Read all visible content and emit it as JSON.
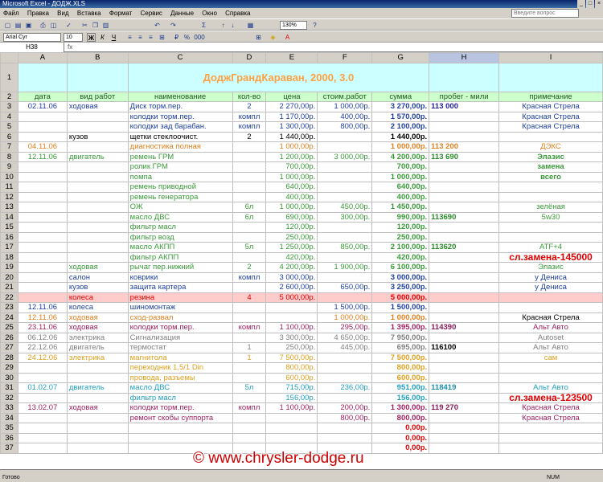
{
  "window": {
    "title": "Microsoft Excel - ДОДЖ.XLS",
    "minimize": "_",
    "maximize": "□",
    "close": "×"
  },
  "menu": {
    "items": [
      "Файл",
      "Правка",
      "Вид",
      "Вставка",
      "Формат",
      "Сервис",
      "Данные",
      "Окно",
      "Справка"
    ],
    "help_placeholder": "Введите вопрос"
  },
  "toolbar": {
    "zoom": "130%",
    "font_name": "Arial Cyr",
    "font_size": "10",
    "bold": "Ж",
    "italic": "К",
    "underline": "Ч",
    "sum": "Σ",
    "percent": "%",
    "thousands": "000"
  },
  "formula_bar": {
    "name_box": "H38",
    "fx": "fx"
  },
  "columns": [
    "A",
    "B",
    "C",
    "D",
    "E",
    "F",
    "G",
    "H",
    "I"
  ],
  "selected_column": "H",
  "banner_title": "ДоджГрандКараван, 2000, 3.0",
  "headers": [
    "дата",
    "вид работ",
    "наименование",
    "кол-во",
    "цена",
    "стоим.работ",
    "сумма",
    "пробег - мили",
    "примечание"
  ],
  "rows": [
    {
      "n": "3",
      "a": "02.11.06",
      "b": "ходовая",
      "c": "Диск торм.пер.",
      "d": "2",
      "e": "2 270,00р.",
      "f": "1 000,00р.",
      "g": "3 270,00р.",
      "h": "113 000",
      "i": "Красная Стрела",
      "color": "#1f3fa0",
      "hcolor": "#1f1f9f"
    },
    {
      "n": "4",
      "a": "",
      "b": "",
      "c": "колодки торм.пер.",
      "d": "компл",
      "e": "1 170,00р.",
      "f": "400,00р.",
      "g": "1 570,00р.",
      "h": "",
      "i": "Красная Стрела",
      "color": "#1f3fa0"
    },
    {
      "n": "5",
      "a": "",
      "b": "",
      "c": "колодки зад барабан.",
      "d": "компл",
      "e": "1 300,00р.",
      "f": "800,00р.",
      "g": "2 100,00р.",
      "h": "",
      "i": "Красная Стрела",
      "color": "#1f3fa0"
    },
    {
      "n": "6",
      "a": "",
      "b": "кузов",
      "c": "щетки стеклоочист.",
      "d": "2",
      "e": "1 440,00р.",
      "f": "",
      "g": "1 440,00р.",
      "h": "",
      "i": "",
      "color": "#000000"
    },
    {
      "n": "7",
      "a": "04.11.06",
      "b": "",
      "c": "диагностика полная",
      "d": "",
      "e": "1 000,00р.",
      "f": "",
      "g": "1 000,00р.",
      "h": "113 200",
      "i": "ДЭКС",
      "color": "#e08020",
      "hcolor": "#e08020"
    },
    {
      "n": "8",
      "a": "12.11.06",
      "b": "двигатель",
      "c": "ремень ГРМ",
      "d": "",
      "e": "1 200,00р.",
      "f": "3 000,00р.",
      "g": "4 200,00р.",
      "h": "113 690",
      "i": "Элазис",
      "color": "#3a9a3a",
      "hcolor": "#2a8a2a",
      "ibold": true
    },
    {
      "n": "9",
      "a": "",
      "b": "",
      "c": "ролик ГРМ",
      "d": "",
      "e": "700,00р.",
      "f": "",
      "g": "700,00р.",
      "h": "",
      "i": "замена",
      "color": "#3a9a3a",
      "ibold": true
    },
    {
      "n": "10",
      "a": "",
      "b": "",
      "c": "помпа",
      "d": "",
      "e": "1 000,00р.",
      "f": "",
      "g": "1 000,00р.",
      "h": "",
      "i": "всего",
      "color": "#3a9a3a",
      "ibold": true
    },
    {
      "n": "11",
      "a": "",
      "b": "",
      "c": "ремень приводной",
      "d": "",
      "e": "640,00р.",
      "f": "",
      "g": "640,00р.",
      "h": "",
      "i": "",
      "color": "#3a9a3a"
    },
    {
      "n": "12",
      "a": "",
      "b": "",
      "c": "ремень генератора",
      "d": "",
      "e": "400,00р.",
      "f": "",
      "g": "400,00р.",
      "h": "",
      "i": "",
      "color": "#3a9a3a"
    },
    {
      "n": "13",
      "a": "",
      "b": "",
      "c": "ОЖ",
      "d": "6л",
      "e": "1 000,00р.",
      "f": "450,00р.",
      "g": "1 450,00р.",
      "h": "",
      "i": "зелёная",
      "color": "#3a9a3a"
    },
    {
      "n": "14",
      "a": "",
      "b": "",
      "c": "масло ДВС",
      "d": "6л",
      "e": "690,00р.",
      "f": "300,00р.",
      "g": "990,00р.",
      "h": "113690",
      "i": "5w30",
      "color": "#3a9a3a",
      "hcolor": "#2a8a2a"
    },
    {
      "n": "15",
      "a": "",
      "b": "",
      "c": "фильтр масл",
      "d": "",
      "e": "120,00р.",
      "f": "",
      "g": "120,00р.",
      "h": "",
      "i": "",
      "color": "#3a9a3a"
    },
    {
      "n": "16",
      "a": "",
      "b": "",
      "c": "фильтр возд",
      "d": "",
      "e": "250,00р.",
      "f": "",
      "g": "250,00р.",
      "h": "",
      "i": "",
      "color": "#3a9a3a"
    },
    {
      "n": "17",
      "a": "",
      "b": "",
      "c": "масло АКПП",
      "d": "5л",
      "e": "1 250,00р.",
      "f": "850,00р.",
      "g": "2 100,00р.",
      "h": "113620",
      "i": "ATF+4",
      "color": "#3a9a3a",
      "hcolor": "#2a8a2a"
    },
    {
      "n": "18",
      "a": "",
      "b": "",
      "c": "фильтр АКПП",
      "d": "",
      "e": "420,00р.",
      "f": "",
      "g": "420,00р.",
      "h": "",
      "i": "сл.замена-145000",
      "color": "#3a9a3a",
      "icolor": "#e00000",
      "ibold": true,
      "ibig": true
    },
    {
      "n": "19",
      "a": "",
      "b": "ходовая",
      "c": "рычаг пер.нижний",
      "d": "2",
      "e": "4 200,00р.",
      "f": "1 900,00р.",
      "g": "6 100,00р.",
      "h": "",
      "i": "Элазис",
      "color": "#3a9a3a"
    },
    {
      "n": "20",
      "a": "",
      "b": "салон",
      "c": "коврики",
      "d": "компл",
      "e": "3 000,00р.",
      "f": "",
      "g": "3 000,00р.",
      "h": "",
      "i": "у Дениса",
      "color": "#1f3fa0"
    },
    {
      "n": "21",
      "a": "",
      "b": "кузов",
      "c": "защита картера",
      "d": "",
      "e": "2 600,00р.",
      "f": "650,00р.",
      "g": "3 250,00р.",
      "h": "",
      "i": "у Дениса",
      "color": "#1f3fa0"
    },
    {
      "n": "22",
      "a": "",
      "b": "колеса",
      "c": "резина",
      "d": "4",
      "e": "5 000,00р.",
      "f": "",
      "g": "5 000,00р.",
      "h": "",
      "i": "",
      "color": "#e00000",
      "bg": "#ffcccc"
    },
    {
      "n": "23",
      "a": "12.11.06",
      "b": "колеса",
      "c": "шиномонтаж",
      "d": "",
      "e": "",
      "f": "1 500,00р.",
      "g": "1 500,00р.",
      "h": "",
      "i": "",
      "color": "#1f3fa0"
    },
    {
      "n": "24",
      "a": "12.11.06",
      "b": "ходовая",
      "c": "сход-развал",
      "d": "",
      "e": "",
      "f": "1 000,00р.",
      "g": "1 000,00р.",
      "h": "",
      "i": "Красная Стрела",
      "color": "#e08020",
      "icolor": "#000000"
    },
    {
      "n": "25",
      "a": "23.11.06",
      "b": "ходовая",
      "c": "колодки торм.пер.",
      "d": "компл",
      "e": "1 100,00р.",
      "f": "295,00р.",
      "g": "1 395,00р.",
      "h": "114390",
      "i": "Альт Авто",
      "color": "#a02060",
      "hcolor": "#8a1a5a"
    },
    {
      "n": "26",
      "a": "06.12.06",
      "b": "электрика",
      "c": "Сигнализация",
      "d": "",
      "e": "3 300,00р.",
      "f": "4 650,00р.",
      "g": "7 950,00р.",
      "h": "",
      "i": "Autoset",
      "color": "#808080"
    },
    {
      "n": "27",
      "a": "22.12.06",
      "b": "двигатель",
      "c": "термостат",
      "d": "1",
      "e": "250,00р.",
      "f": "445,00р.",
      "g": "695,00р.",
      "h": "116100",
      "i": "Альт Авто",
      "color": "#808080",
      "hcolor": "#000000"
    },
    {
      "n": "28",
      "a": "24.12.06",
      "b": "электрика",
      "c": "магнитола",
      "d": "1",
      "e": "7 500,00р.",
      "f": "",
      "g": "7 500,00р.",
      "h": "",
      "i": "сам",
      "color": "#e0a020"
    },
    {
      "n": "29",
      "a": "",
      "b": "",
      "c": "переходник 1,5/1 Din",
      "d": "",
      "e": "800,00р.",
      "f": "",
      "g": "800,00р.",
      "h": "",
      "i": "",
      "color": "#e0a020"
    },
    {
      "n": "30",
      "a": "",
      "b": "",
      "c": "провода, разъемы",
      "d": "",
      "e": "600,00р.",
      "f": "",
      "g": "600,00р.",
      "h": "",
      "i": "",
      "color": "#e0a020"
    },
    {
      "n": "31",
      "a": "01.02.07",
      "b": "двигатель",
      "c": "масло ДВС",
      "d": "5л",
      "e": "715,00р.",
      "f": "236,00р.",
      "g": "951,00р.",
      "h": "118419",
      "i": "Альт Авто",
      "color": "#20a0c0",
      "hcolor": "#1a90b0"
    },
    {
      "n": "32",
      "a": "",
      "b": "",
      "c": "фильтр масл",
      "d": "",
      "e": "156,00р.",
      "f": "",
      "g": "156,00р.",
      "h": "",
      "i": "сл.замена-123500",
      "color": "#20a0c0",
      "icolor": "#e00000",
      "ibold": true,
      "ibig": true
    },
    {
      "n": "33",
      "a": "13.02.07",
      "b": "ходовая",
      "c": "колодки торм.пер.",
      "d": "компл",
      "e": "1 100,00р.",
      "f": "200,00р.",
      "g": "1 300,00р.",
      "h": "119 270",
      "i": "Красная Стрела",
      "color": "#a02060",
      "hcolor": "#8a1a5a"
    },
    {
      "n": "34",
      "a": "",
      "b": "",
      "c": "ремонт скобы суппорта",
      "d": "",
      "e": "",
      "f": "800,00р.",
      "g": "800,00р.",
      "h": "",
      "i": "Красная Стрела",
      "color": "#a02060"
    },
    {
      "n": "35",
      "a": "",
      "b": "",
      "c": "",
      "d": "",
      "e": "",
      "f": "",
      "g": "0,00р.",
      "h": "",
      "i": "",
      "color": "#e00000"
    },
    {
      "n": "36",
      "a": "",
      "b": "",
      "c": "",
      "d": "",
      "e": "",
      "f": "",
      "g": "0,00р.",
      "h": "",
      "i": "",
      "color": "#e00000"
    },
    {
      "n": "37",
      "a": "",
      "b": "",
      "c": "",
      "d": "",
      "e": "",
      "f": "",
      "g": "0,00р.",
      "h": "",
      "i": "",
      "color": "#e00000"
    }
  ],
  "status": {
    "ready": "Готово",
    "num": "NUM"
  },
  "watermark": "© www.chrysler-dodge.ru"
}
